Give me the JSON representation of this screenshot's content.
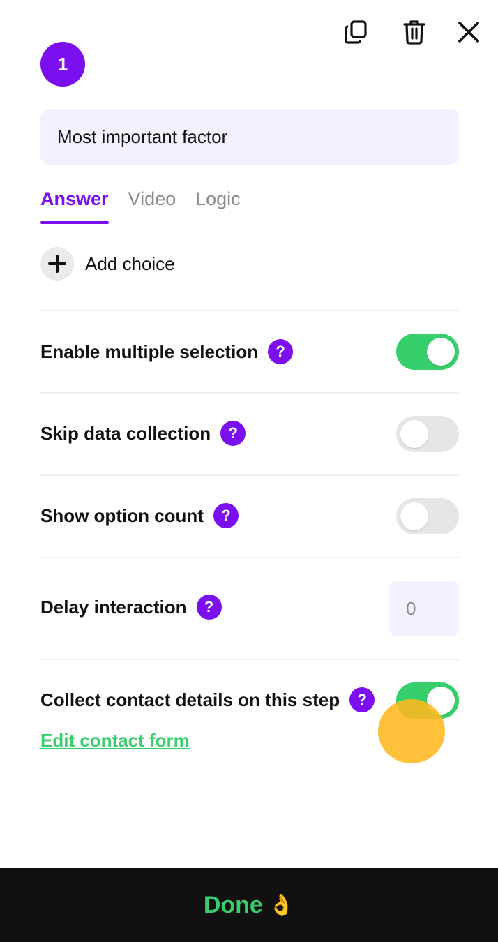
{
  "header": {
    "step_number": "1",
    "duplicate_icon": "duplicate-icon",
    "delete_icon": "trash-icon",
    "close_icon": "close-icon"
  },
  "question": {
    "value": "Most important factor"
  },
  "tabs": [
    {
      "label": "Answer",
      "active": true
    },
    {
      "label": "Video",
      "active": false
    },
    {
      "label": "Logic",
      "active": false
    }
  ],
  "add_choice": {
    "label": "Add choice",
    "icon": "plus-icon"
  },
  "settings": {
    "multiple_selection": {
      "label": "Enable multiple selection",
      "help": "?",
      "enabled": true
    },
    "skip_data": {
      "label": "Skip data collection",
      "help": "?",
      "enabled": false
    },
    "option_count": {
      "label": "Show option count",
      "help": "?",
      "enabled": false
    },
    "delay": {
      "label": "Delay interaction",
      "help": "?",
      "value": "0"
    },
    "contact": {
      "label": "Collect contact details on this step",
      "help": "?",
      "enabled": true,
      "link": "Edit contact form"
    }
  },
  "footer": {
    "done_label": "Done",
    "done_emoji": "👌"
  },
  "colors": {
    "accent": "#7b0fef",
    "toggle_on": "#36cf6c",
    "toggle_off": "#e6e6e6",
    "field_bg": "#f5f0ff",
    "footer_bg": "#111111"
  }
}
